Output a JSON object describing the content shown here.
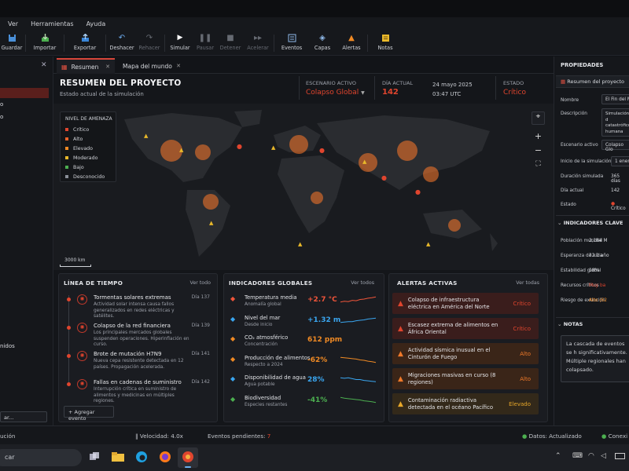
{
  "menu": [
    "Ver",
    "Herramientas",
    "Ayuda"
  ],
  "toolbar": {
    "guardar": "Guardar",
    "importar": "Importar",
    "exportar": "Exportar",
    "deshacer": "Deshacer",
    "rehacer": "Rehacer",
    "simular": "Simular",
    "pausar": "Pausar",
    "detener": "Detener",
    "acelerar": "Acelerar",
    "eventos": "Eventos",
    "capas": "Capas",
    "alertas": "Alertas",
    "notas": "Notas"
  },
  "left": {
    "item_frag1": "o",
    "item_frag2": "o",
    "item_frag3": "nidos",
    "input_frag": "ar..."
  },
  "tabs": [
    {
      "label": "Resumen"
    },
    {
      "label": "Mapa del mundo"
    }
  ],
  "header": {
    "title": "RESUMEN DEL PROYECTO",
    "subtitle": "Estado actual de la simulación",
    "scenario_label": "ESCENARIO ACTIVO",
    "scenario_value": "Colapso Global",
    "day_label": "DÍA ACTUAL",
    "day_value": "142",
    "date": "24 mayo 2025",
    "time": "03:47 UTC",
    "state_label": "ESTADO",
    "state_value": "Crítico"
  },
  "legend": {
    "title": "NIVEL DE AMENAZA",
    "items": [
      {
        "label": "Crítico",
        "color": "#e0452e"
      },
      {
        "label": "Alto",
        "color": "#e8622a"
      },
      {
        "label": "Elevado",
        "color": "#f08a24"
      },
      {
        "label": "Moderado",
        "color": "#e8b82a"
      },
      {
        "label": "Bajo",
        "color": "#4caf50"
      },
      {
        "label": "Desconocido",
        "color": "#8a8f98"
      }
    ]
  },
  "scale": "3000 km",
  "timeline": {
    "title": "LÍNEA DE TIEMPO",
    "see_all": "Ver todo",
    "add": "Agregar evento",
    "events": [
      {
        "title": "Tormentas solares extremas",
        "desc": "Actividad solar intensa causa fallos generalizados en redes eléctricas y satélites.",
        "day": "Día 137",
        "icon": "sun-storm-icon"
      },
      {
        "title": "Colapso de la red financiera",
        "desc": "Los principales mercados globales suspenden operaciones. Hiperinflación en curso.",
        "day": "Día 139",
        "icon": "bank-icon"
      },
      {
        "title": "Brote de mutación H7N9",
        "desc": "Nueva cepa resistente detectada en 12 países. Propagación acelerada.",
        "day": "Día 141",
        "icon": "biohazard-icon"
      },
      {
        "title": "Fallas en cadenas de suministro",
        "desc": "Interrupción crítica en suministro de alimentos y medicinas en múltiples regiones.",
        "day": "Día 142",
        "icon": "fire-icon"
      }
    ]
  },
  "indicators": {
    "title": "INDICADORES GLOBALES",
    "see_all": "Ver todos",
    "items": [
      {
        "name": "Temperatura media",
        "sub": "Anomalía global",
        "value": "+2.7 °C",
        "color": "#f0553a",
        "icon": "thermometer-icon"
      },
      {
        "name": "Nivel del mar",
        "sub": "Desde inicio",
        "value": "+1.32 m",
        "color": "#3aa6f0",
        "icon": "sea-level-icon"
      },
      {
        "name": "CO₂ atmosférico",
        "sub": "Concentración",
        "value": "612 ppm",
        "color": "#f08a24",
        "icon": "warning-icon"
      },
      {
        "name": "Producción de alimentos",
        "sub": "Respecto a 2024",
        "value": "-62%",
        "color": "#f08a24",
        "icon": "wheat-icon"
      },
      {
        "name": "Disponibilidad de agua",
        "sub": "Agua potable",
        "value": "28%",
        "color": "#3aa6f0",
        "icon": "water-drop-icon"
      },
      {
        "name": "Biodiversidad",
        "sub": "Especies restantes",
        "value": "-41%",
        "color": "#4caf50",
        "icon": "leaf-icon"
      }
    ]
  },
  "alerts": {
    "title": "ALERTAS ACTIVAS",
    "see_all": "Ver todas",
    "items": [
      {
        "text": "Colapso de infraestructura eléctrica en América del Norte",
        "level": "Crítico",
        "color": "#e0452e",
        "bg": "#3a1d1c"
      },
      {
        "text": "Escasez extrema de alimentos en África Oriental",
        "level": "Crítico",
        "color": "#e0452e",
        "bg": "#3a1d1c"
      },
      {
        "text": "Actividad sísmica inusual en el Cinturón de Fuego",
        "level": "Alto",
        "color": "#f07a2a",
        "bg": "#3a2518"
      },
      {
        "text": "Migraciones masivas en curso (8 regiones)",
        "level": "Alto",
        "color": "#f07a2a",
        "bg": "#3a2518"
      },
      {
        "text": "Contaminación radiactiva detectada en el océano Pacífico",
        "level": "Elevado",
        "color": "#e8a82a",
        "bg": "#33291a"
      }
    ]
  },
  "props": {
    "title": "PROPIEDADES",
    "node": "Resumen del proyecto",
    "name_label": "Nombre",
    "name_value": "El Fin del M",
    "desc_label": "Descripción",
    "desc_value": "Simulación d catastrófico humana",
    "scenario_label": "Escenario activo",
    "scenario_value": "Colapso Glo",
    "start_label": "Inicio de la simulación",
    "start_value": "1 enero",
    "duration_label": "Duración simulada",
    "duration_value": "365 días",
    "day_label": "Día actual",
    "day_value": "142",
    "state_label": "Estado",
    "state_value": "Crítico"
  },
  "keyind": {
    "title": "INDICADORES CLAVE",
    "items": [
      {
        "label": "Población mundial",
        "value": "2,184 M",
        "color": "#d8dadf"
      },
      {
        "label": "Esperanza de vida",
        "value": "32.1 año",
        "color": "#d8dadf"
      },
      {
        "label": "Estabilidad global",
        "value": "18%",
        "color": "#d8dadf"
      },
      {
        "label": "Recursos críticos",
        "value": "Muy ba",
        "color": "#e0452e"
      },
      {
        "label": "Riesgo de extinción",
        "value": "Alto (62",
        "color": "#f08a24"
      }
    ]
  },
  "notes": {
    "title": "NOTAS",
    "text": "La cascada de eventos se h significativamente. Múltiple regionales han colapsado."
  },
  "status": {
    "left": "ución",
    "speed": "Velocidad: 4.0x",
    "pending_label": "Eventos pendientes:",
    "pending_value": "7",
    "data": "Datos: Actualizado",
    "conn": "Conexi"
  },
  "taskbar": {
    "search": "car"
  }
}
